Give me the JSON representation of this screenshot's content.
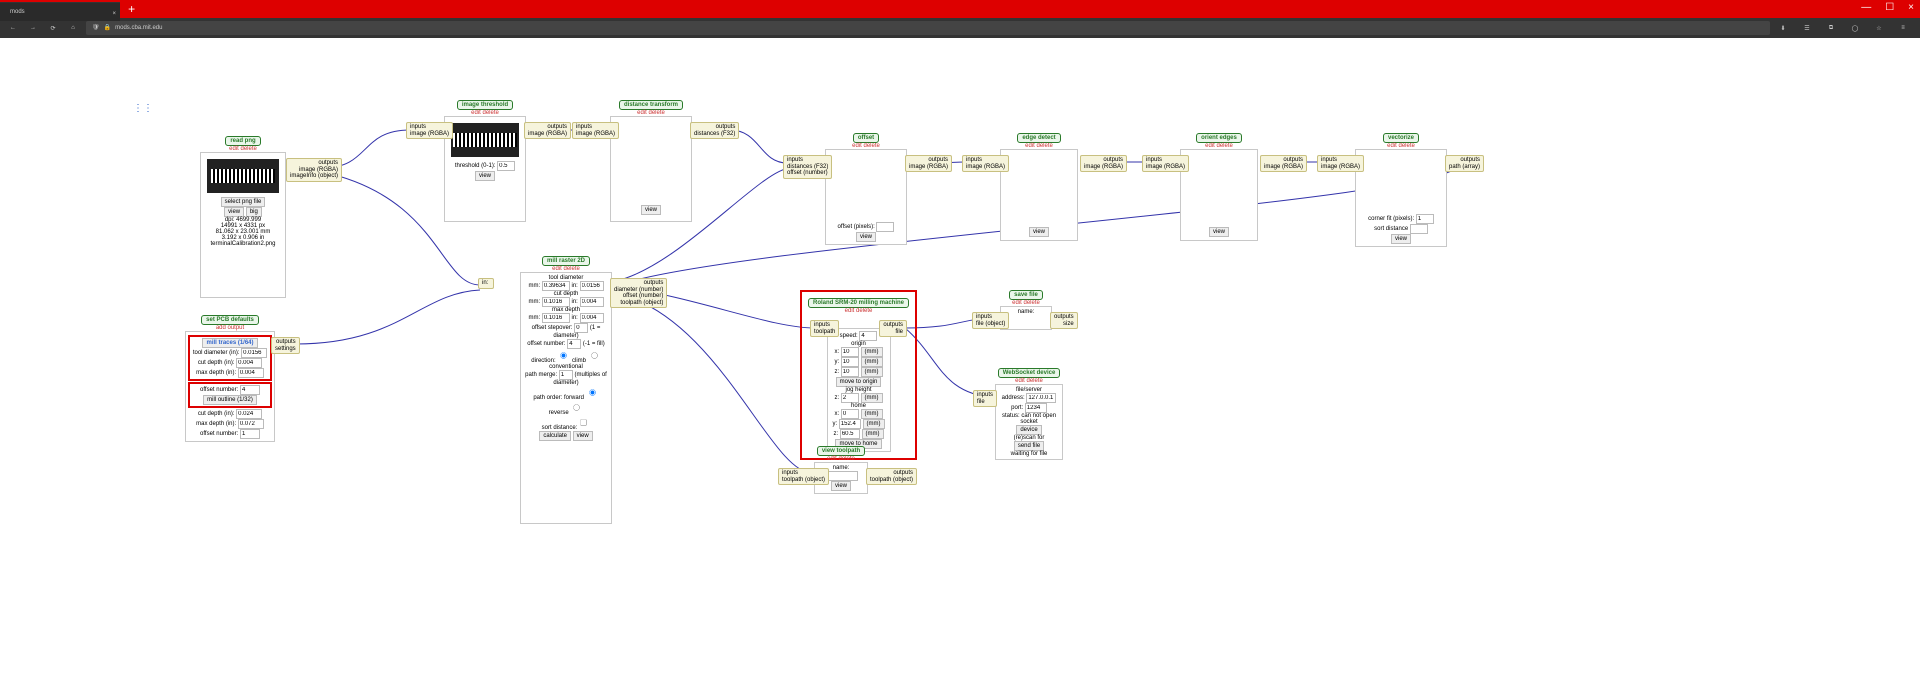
{
  "browser": {
    "tab": "mods",
    "close": "×",
    "newtab": "+",
    "win": {
      "min": "—",
      "max": "☐",
      "close": "×"
    },
    "url": "mods.cba.mit.edu",
    "icons": {
      "back": "←",
      "fwd": "→",
      "reload": "⟳",
      "home": "⌂",
      "shield": "🛡",
      "lock": "🔒",
      "download": "⬇",
      "library": "☰",
      "ext": "⧉",
      "account": "◯",
      "star": "☆",
      "menu": "≡"
    }
  },
  "ui": {
    "grid": "⋮⋮",
    "edit": "edit",
    "delete": "delete"
  },
  "readpng": {
    "title": "read png",
    "out": "outputs\nimage (RGBA)\nimageInfo (object)",
    "btn": "select png file",
    "view": "view",
    "big": "big",
    "dpi": "dpi: 4699.999",
    "px": "14991 x 4331 px",
    "mm": "81.062 x 23.001 mm",
    "inch": "3.192 x 0.906 in",
    "file": "terminalCalibration2.png"
  },
  "thresh": {
    "title": "image threshold",
    "in": "inputs\nimage (RGBA)",
    "out": "outputs\nimage (RGBA)",
    "label": "threshold (0-1): ",
    "val": "0.5",
    "view": "view"
  },
  "dist": {
    "title": "distance transform",
    "in": "inputs\nimage (RGBA)",
    "out": "outputs\ndistances (F32)",
    "view": "view"
  },
  "offset": {
    "title": "offset",
    "in": "inputs\ndistances (F32)\noffset (number)",
    "out": "outputs\nimage (RGBA)",
    "label": "offset (pixels): ",
    "val": "",
    "view": "view"
  },
  "edge1": {
    "title": "edge detect",
    "in": "inputs\nimage (RGBA)",
    "out": "outputs\nimage (RGBA)",
    "view": "view"
  },
  "orient": {
    "title": "orient edges",
    "in": "inputs\nimage (RGBA)",
    "out": "outputs\nimage (RGBA)",
    "view": "view"
  },
  "vect": {
    "title": "vectorize",
    "in": "inputs\nimage (RGBA)",
    "out": "outputs\npath (array)",
    "corner": "corner fit (pixels): ",
    "cval": "1",
    "sort": "sort distance",
    "view": "view",
    "sval": ""
  },
  "pcb": {
    "title": "set PCB defaults",
    "ed": "add output",
    "out": "outputs\nsettings",
    "btn1": "mill traces (1/64)",
    "btn2": "mill outline (1/32)",
    "td": "tool diameter (in): ",
    "tdv": "0.0156",
    "cd": "cut depth (in): ",
    "cdv": "0.004",
    "md": "max depth (in): ",
    "mdv": "0.004",
    "on": "offset number: ",
    "onv": "4",
    "cd2": "cut depth (in): ",
    "cd2v": "0.024",
    "md2": "max depth (in): ",
    "md2v": "0.072",
    "on2": "offset number: ",
    "on2v": "1"
  },
  "mill": {
    "title": "mill raster 2D",
    "in": "in: ",
    "out": "outputs\ndiameter (number)\noffset (number)\ntoolpath (object)",
    "td": "tool diameter",
    "mm": "mm: ",
    "mmv": "0.39634",
    "inv": "0.0156",
    "cd": "cut depth",
    "cdmmv": "0.1016",
    "cdinv": "0.004",
    "mxd": "max depth",
    "mdmmv": "0.1016",
    "mdinv": "0.004",
    "os": "offset stepover: ",
    "osv": "0",
    "oshint": "(1 = diameter)",
    "onum": "offset number: ",
    "onv": "4",
    "onhint": "(-1 = fill)",
    "dir": "direction:",
    "climb": "climb",
    "conv": "conventional",
    "pm": "path merge: ",
    "pmv": "1",
    "pmhint": "(multiples of diameter)",
    "po": "path order: forward",
    "rev": "reverse",
    "sd": "sort distance:",
    "sdv": "",
    "calc": "calculate",
    "view": "view"
  },
  "roland": {
    "title": "Roland SRM-20 milling machine",
    "in": "inputs\ntoolpath",
    "out": "outputs\nfile",
    "speed": "speed: ",
    "sv": "4",
    "origin": "origin",
    "x": "x: ",
    "xv": "10",
    "ox": "(mm)",
    "y": "y: ",
    "yv": "10",
    "z": "z: ",
    "zv": "10",
    "m2o": "move to origin",
    "jog": "jog height",
    "zj": "z: ",
    "zjv": "2",
    "home": "home",
    "xh": "x: ",
    "xhv": "0",
    "yh": "y: ",
    "yhv": "152.4",
    "zh": "z: ",
    "zhv": "60.5",
    "m2h": "move to home"
  },
  "save": {
    "title": "save file",
    "in": "inputs\nfile (object)",
    "out": "outputs\nsize",
    "name": "name:"
  },
  "viewtp": {
    "title": "view toolpath",
    "in": "inputs\ntoolpath (object)",
    "out": "outputs\ntoolpath (object)",
    "nl": "name:",
    "nf": "",
    "view": "view"
  },
  "wsd": {
    "title": "WebSocket device",
    "in": "inputs\nfile",
    "address": "   file/server",
    "addr": "address: ",
    "addrv": "127.0.0.1",
    "port": "port: ",
    "portv": "1234",
    "stat": "status:",
    "statv": "can not open socket",
    "dev": "device",
    "dco": "(re)scan for",
    "send": "send file",
    "wff": "waiting for file"
  }
}
